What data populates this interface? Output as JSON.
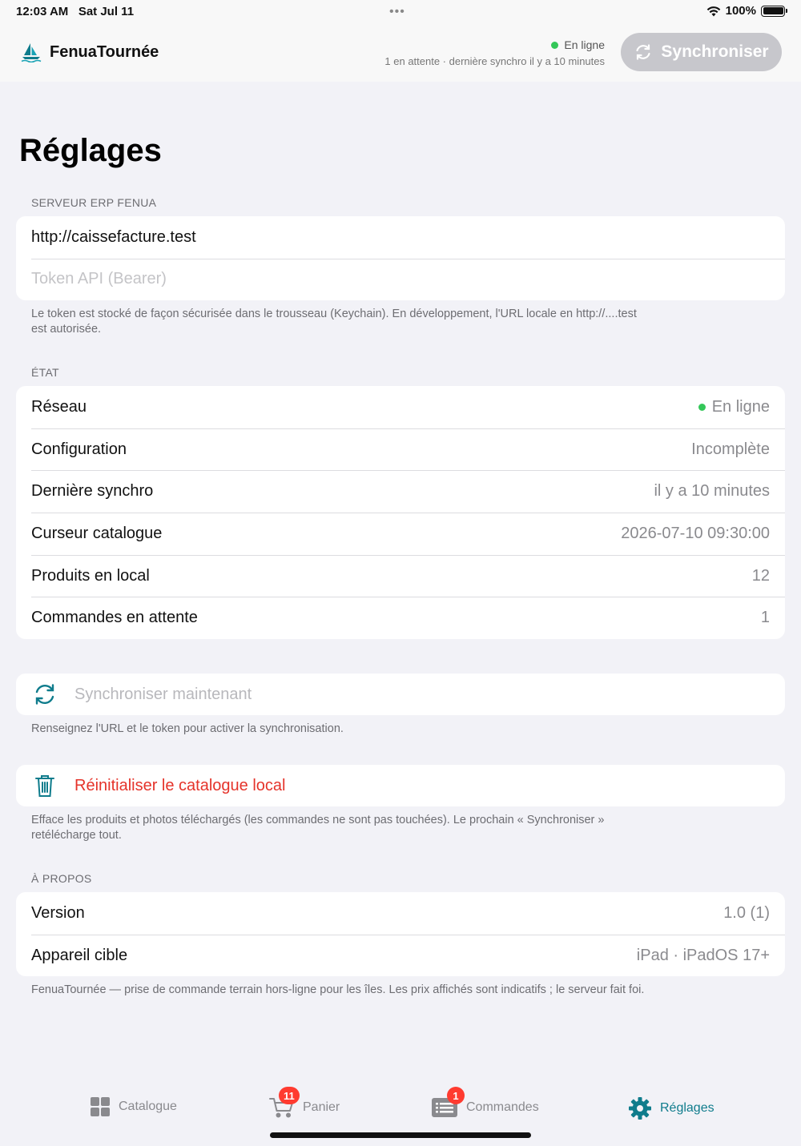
{
  "status_bar": {
    "time": "12:03 AM",
    "date": "Sat Jul 11",
    "battery": "100%"
  },
  "header": {
    "app_name": "FenuaTournée",
    "status": "En ligne",
    "sync_info": "1 en attente · dernière synchro il y a 10 minutes",
    "sync_button": "Synchroniser"
  },
  "page_title": "Réglages",
  "server": {
    "section_title": "SERVEUR ERP FENUA",
    "url_value": "http://caissefacture.test",
    "token_placeholder": "Token API (Bearer)",
    "note_line1": "Le token est stocké de façon sécurisée dans le trousseau (Keychain). En développement, l'URL locale en http://....test",
    "note_line2": "est autorisée."
  },
  "state": {
    "section_title": "ÉTAT",
    "rows": [
      {
        "label": "Réseau",
        "value": "En ligne"
      },
      {
        "label": "Configuration",
        "value": "Incomplète"
      },
      {
        "label": "Dernière synchro",
        "value": "il y a 10 minutes"
      },
      {
        "label": "Curseur catalogue",
        "value": "2026-07-10 09:30:00"
      },
      {
        "label": "Produits en local",
        "value": "12"
      },
      {
        "label": "Commandes en attente",
        "value": "1"
      }
    ],
    "status_color": "#34c759"
  },
  "sync_action": {
    "label": "Synchroniser maintenant",
    "note": "Renseignez l'URL et le token pour activer la synchronisation.",
    "icon": "sync-icon"
  },
  "reset_action": {
    "label": "Réinitialiser le catalogue local",
    "note_line1": "Efface les produits et photos téléchargés (les commandes ne sont pas touchées). Le prochain « Synchroniser »",
    "note_line2": "retélécharge tout.",
    "icon": "trash-icon",
    "color": "#e5332a"
  },
  "about": {
    "section_title": "À PROPOS",
    "rows": [
      {
        "label": "Version",
        "value": "1.0 (1)"
      },
      {
        "label": "Appareil cible",
        "value": "iPad · iPadOS 17+"
      }
    ],
    "note": "FenuaTournée — prise de commande terrain hors-ligne pour les îles. Les prix affichés sont indicatifs ; le serveur fait foi."
  },
  "tabs": [
    {
      "label": "Catalogue",
      "icon": "grid-icon",
      "badge": ""
    },
    {
      "label": "Panier",
      "icon": "cart-icon",
      "badge": "11"
    },
    {
      "label": "Commandes",
      "icon": "list-icon",
      "badge": "1"
    },
    {
      "label": "Réglages",
      "icon": "gear-icon",
      "badge": "",
      "active": true
    }
  ],
  "accent_color": "#0f7c8c"
}
